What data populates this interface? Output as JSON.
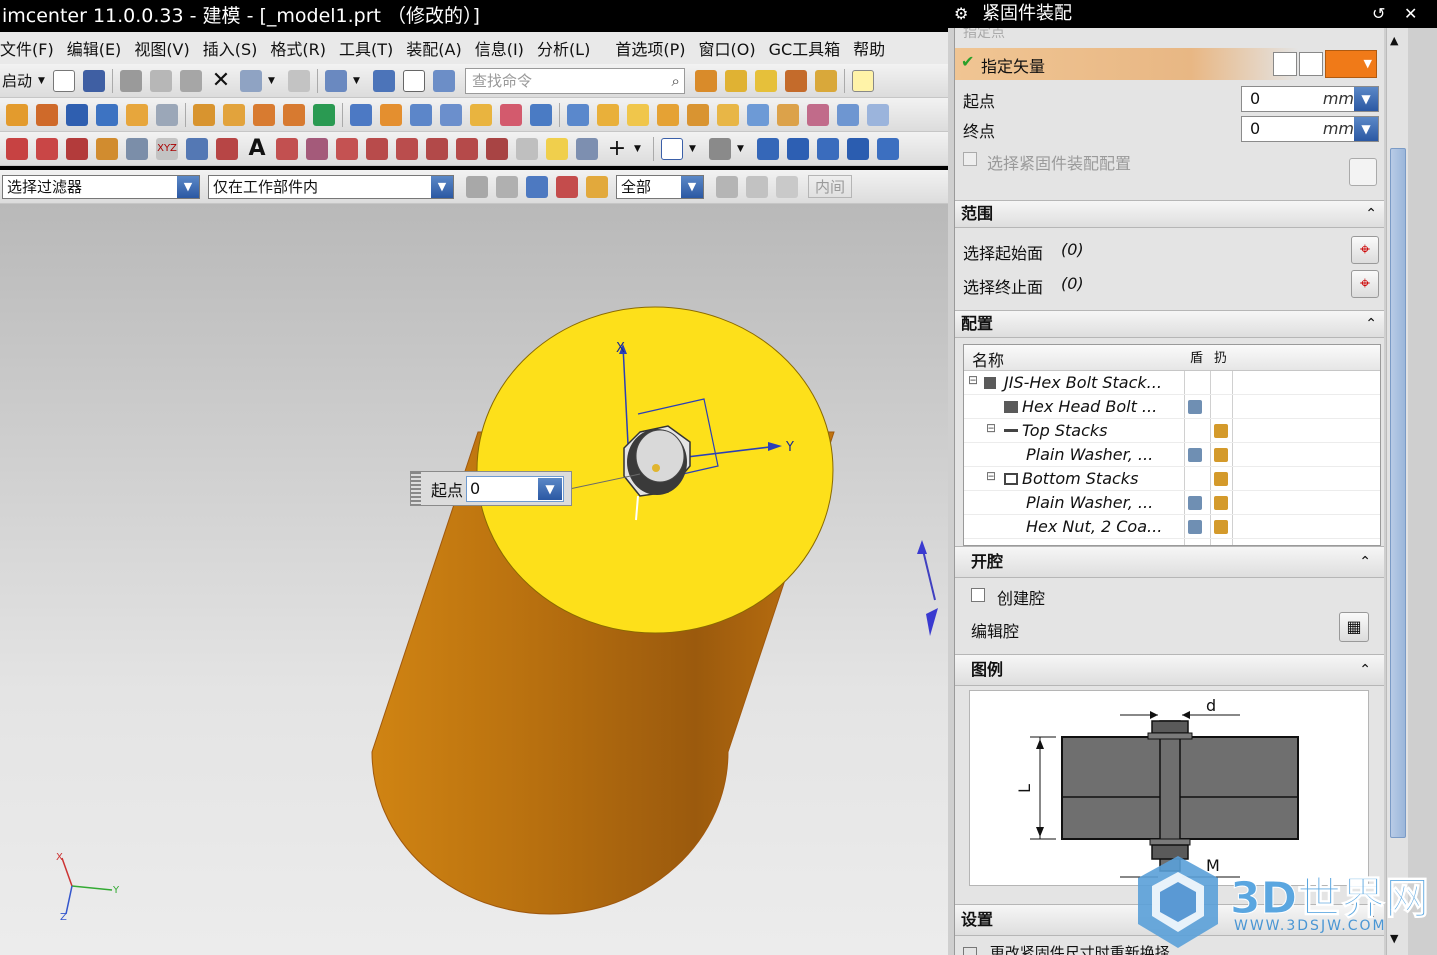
{
  "window": {
    "title": "imcenter 11.0.0.33 - 建模 - [_model1.prt （修改的）]"
  },
  "menu": [
    "文件(F)",
    "编辑(E)",
    "视图(V)",
    "插入(S)",
    "格式(R)",
    "工具(T)",
    "装配(A)",
    "信息(I)",
    "分析(L)",
    "首选项(P)",
    "窗口(O)",
    "GC工具箱",
    "帮助"
  ],
  "toolbar": {
    "start_label": "启动",
    "search_placeholder": "查找命令"
  },
  "filter_bar": {
    "filter_label": "选择过滤器",
    "scope": "仅在工作部件内",
    "mode": "全部",
    "disabled_item": "内间"
  },
  "viewport": {
    "popup": {
      "label": "起点",
      "value": "0"
    },
    "axis_labels": {
      "x": "X",
      "y": "Y"
    },
    "triad_labels": {
      "x": "X",
      "y": "Y",
      "z": "Z"
    },
    "colors": {
      "cylinder_top": "#fde01a",
      "cylinder_side": "#c27410",
      "background_top": "#b9b9b9"
    }
  },
  "panel": {
    "title": "紧固件装配",
    "top_partial": "指定点",
    "vector_label": "指定矢量",
    "start_label": "起点",
    "start_value": "0",
    "end_label": "终点",
    "end_value": "0",
    "unit": "mm",
    "checkbox_label": "选择紧固件装配配置",
    "sections": {
      "range": {
        "title": "范围",
        "items": [
          {
            "label": "选择起始面",
            "count": "(0)"
          },
          {
            "label": "选择终止面",
            "count": "(0)"
          }
        ]
      },
      "config": {
        "title": "配置",
        "columns": [
          "名称",
          "盾",
          "扔"
        ],
        "rows": [
          {
            "name": "JIS-Hex Bolt Stack...",
            "level": 0,
            "expander": "⊟"
          },
          {
            "name": "Hex Head Bolt ...",
            "level": 1,
            "expander": ""
          },
          {
            "name": "Top Stacks",
            "level": 1,
            "expander": "⊟"
          },
          {
            "name": "Plain Washer, ...",
            "level": 2,
            "expander": ""
          },
          {
            "name": "Bottom Stacks",
            "level": 1,
            "expander": "⊟"
          },
          {
            "name": "Plain Washer, ...",
            "level": 2,
            "expander": ""
          },
          {
            "name": "Hex Nut, 2 Coa...",
            "level": 2,
            "expander": ""
          }
        ]
      },
      "cavity": {
        "title": "开腔",
        "create_label": "创建腔",
        "edit_label": "编辑腔"
      },
      "legend": {
        "title": "图例",
        "dim_d": "d",
        "dim_L": "L",
        "dim_M": "M"
      },
      "settings": {
        "title": "设置",
        "partial_row": "更改紧固件尺寸时重新换择"
      }
    }
  },
  "watermark": {
    "brand": "3D世界网",
    "url": "WWW.3DSJW.COM"
  }
}
